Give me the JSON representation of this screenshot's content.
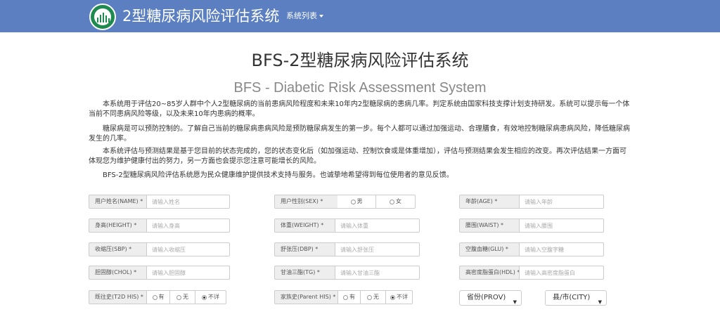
{
  "header": {
    "brand": "2型糖尿病风险评估系统",
    "menu_label": "系统列表"
  },
  "page": {
    "title_cn": "BFS-2型糖尿病风险评估系统",
    "title_en": "BFS - Diabetic Risk Assessment System",
    "paragraphs": [
      "本系统用于评估20~85岁人群中个人2型糖尿病的当前患病风险程度和未来10年内2型糖尿病的患病几率。判定系统由国家科技支撑计划支持研发。系统可以提示每一个体当前不同患病风险等级，以及未来10年内患病的概率。",
      "糖尿病是可以预防控制的。了解自己当前的糖尿病患病风险是预防糖尿病发生的第一步。每个人都可以通过加强运动、合理膳食，有效地控制糖尿病患病风险，降低糖尿病发生的几率。",
      "本系统评估与预测结果是基于您目前的状态完成的，您的状态变化后（如加强运动、控制饮食或是体重增加），评估与预测结果会发生相应的改变。再次评估结果一方面可体现您为维护健康付出的努力，另一方面也会提示您注意可能增长的风险。",
      "BFS-2型糖尿病风险评估系统愿为民众健康维护提供技术支持与服务。也诚挚地希望得到每位使用者的意见反馈。"
    ]
  },
  "form": {
    "name": {
      "label": "用户姓名(NAME) *",
      "placeholder": "请输入姓名"
    },
    "sex": {
      "label": "用户性别(SEX) *",
      "options": [
        "男",
        "女"
      ]
    },
    "age": {
      "label": "年龄(AGE) *",
      "placeholder": "请输入年龄"
    },
    "height": {
      "label": "身高(HEIGHT) *",
      "placeholder": "请输入身高"
    },
    "weight": {
      "label": "体重(WEIGHT) *",
      "placeholder": "请输入体重"
    },
    "waist": {
      "label": "腰围(WAIST) *",
      "placeholder": "请输入腰围"
    },
    "sbp": {
      "label": "收缩压(SBP) *",
      "placeholder": "请输入收缩压"
    },
    "dbp": {
      "label": "舒张压(DBP) *",
      "placeholder": "请输入舒张压"
    },
    "glu": {
      "label": "空腹血糖(GLU) *",
      "placeholder": "请输入空腹字糖"
    },
    "chol": {
      "label": "胆固醇(CHOL) *",
      "placeholder": "请输入胆固醇"
    },
    "tg": {
      "label": "甘油三酯(TG) *",
      "placeholder": "请输入甘油三酯"
    },
    "hdl": {
      "label": "高密度脂蛋白(HDL) *",
      "placeholder": "请输入高密度脂蛋白"
    },
    "t2d_his": {
      "label": "既往史(T2D HIS) *",
      "options": [
        "有",
        "无",
        "不详"
      ],
      "selected": "不详"
    },
    "parent_his": {
      "label": "家族史(Parent HIS) *",
      "options": [
        "有",
        "无",
        "不详"
      ],
      "selected": "不详"
    },
    "province": {
      "value": "省份(PROV)"
    },
    "city": {
      "value": "县/市(CITY)"
    }
  },
  "colors": {
    "navbar": "#5b7fc0",
    "logo": "#1f8a4f"
  }
}
